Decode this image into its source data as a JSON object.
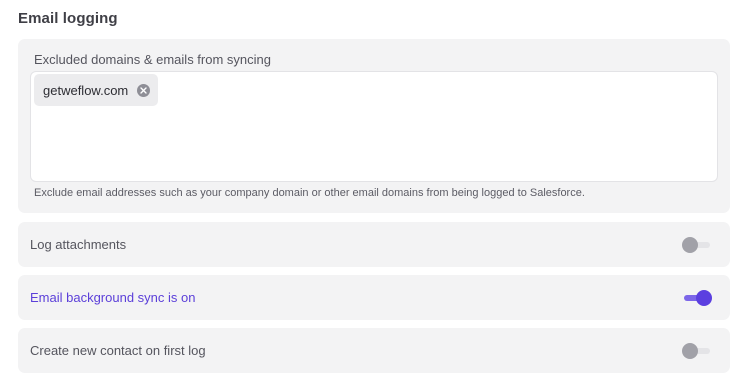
{
  "section": {
    "title": "Email logging"
  },
  "excluded_domains": {
    "label": "Excluded domains & emails from syncing",
    "chips": [
      {
        "text": "getweflow.com"
      }
    ],
    "hint": "Exclude email addresses such as your company domain or other email domains from being logged to Salesforce."
  },
  "settings": [
    {
      "label": "Log attachments",
      "enabled": false
    },
    {
      "label": "Email background sync is on",
      "enabled": true
    },
    {
      "label": "Create new contact on first log",
      "enabled": false
    }
  ],
  "colors": {
    "accent": "#5b3fe0",
    "active_label": "#5b3fd9",
    "panel_bg": "#f3f3f4"
  },
  "icons": {
    "chip_remove": "x-circle-icon"
  }
}
